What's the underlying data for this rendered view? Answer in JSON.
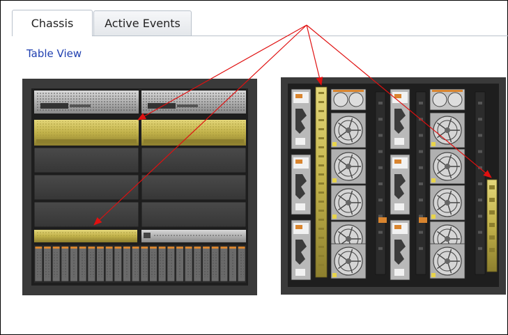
{
  "tabs": [
    {
      "label": "Chassis",
      "active": true
    },
    {
      "label": "Active Events",
      "active": false
    }
  ],
  "view_link": "Table View",
  "colors": {
    "chassis_bg": "#3a3a3a",
    "highlight_gold": "#c8b84a",
    "fan_orange": "#d9852f",
    "arrow_red": "#e01010",
    "link_blue": "#1f3fb0"
  },
  "icons": [
    "fan-icon",
    "power-supply-icon",
    "io-module-icon"
  ]
}
